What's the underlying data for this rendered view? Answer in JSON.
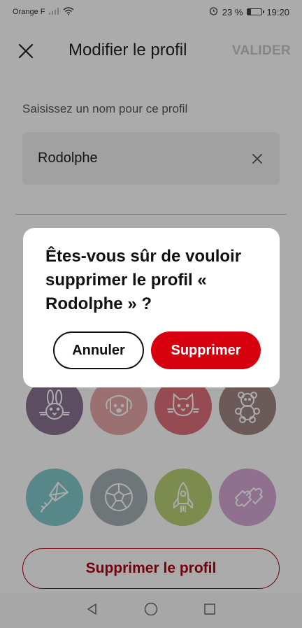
{
  "status_bar": {
    "carrier": "Orange F",
    "battery": "23 %",
    "battery_level": 0.23,
    "time": "19:20"
  },
  "header": {
    "title": "Modifier le profil",
    "validate_label": "VALIDER"
  },
  "name_form": {
    "label": "Saisissez un nom pour ce profil",
    "value": "Rodolphe"
  },
  "avatars": [
    {
      "name": "rabbit-icon",
      "color": "#8a7394"
    },
    {
      "name": "dog-icon",
      "color": "#e8a8a8"
    },
    {
      "name": "cat-icon",
      "color": "#e0707c"
    },
    {
      "name": "teddy-bear-icon",
      "color": "#a08782"
    },
    {
      "name": "kite-icon",
      "color": "#82c9cc"
    },
    {
      "name": "soccer-ball-icon",
      "color": "#a6b0b5"
    },
    {
      "name": "rocket-icon",
      "color": "#b9d075"
    },
    {
      "name": "puzzle-icon",
      "color": "#d6a8d6"
    }
  ],
  "delete_profile_label": "Supprimer le profil",
  "dialog": {
    "message": "Êtes-vous sûr de vouloir supprimer le profil « Rodolphe » ?",
    "cancel_label": "Annuler",
    "confirm_label": "Supprimer"
  },
  "colors": {
    "brand_red": "#d6000f",
    "overlay": "rgba(0,0,0,0.33)"
  }
}
